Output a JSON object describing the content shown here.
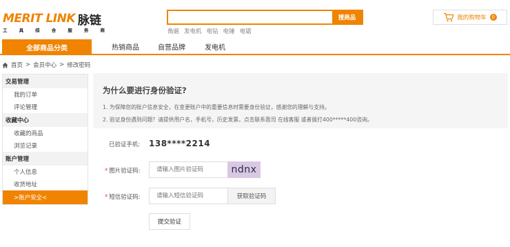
{
  "logo": {
    "english": "MERIT LINK",
    "chinese": "脉链",
    "tagline": [
      "工",
      "具",
      "综",
      "合",
      "服",
      "务",
      "商"
    ]
  },
  "search": {
    "placeholder": "",
    "button": "搜商品",
    "hot_words": [
      "角磨",
      "发电机",
      "电钻",
      "电锤",
      "电锯"
    ]
  },
  "cart": {
    "label": "我的购物车",
    "count": "0"
  },
  "nav": {
    "all_categories": "全部商品分类",
    "items": [
      "热销商品",
      "自营品牌",
      "发电机"
    ]
  },
  "breadcrumb": {
    "items": [
      "首页",
      ">",
      "会员中心",
      ">",
      "修改密码"
    ]
  },
  "sidebar": {
    "groups": [
      {
        "title": "交易管理",
        "items": [
          "我的订单",
          "评论管理"
        ]
      },
      {
        "title": "收藏中心",
        "items": [
          "收藏的商品",
          "浏览记录"
        ]
      },
      {
        "title": "账户管理",
        "items": [
          "个人信息",
          "收货地址",
          ">账户安全<"
        ]
      }
    ],
    "active_item": ">账户安全<"
  },
  "info": {
    "title": "为什么要进行身份验证?",
    "line1": "1. 为保障您的账户信息安全，在变更账户中的重要信息时需要身份验证，感谢您的理解与支持。",
    "line2": "2. 验证身份遇到问题？请提供用户名，手机号，历史发票，点击联系我司 在线客服 或者拨打400*****400咨询。"
  },
  "form": {
    "phone_label": "已验证手机:",
    "phone_value": "138****2214",
    "required_mark": "*",
    "image_code_label": "图片验证码:",
    "image_code_placeholder": "请输入图片验证码",
    "captcha_text": "ndnx",
    "sms_code_label": "短信验证码:",
    "sms_code_placeholder": "请输入短信验证码",
    "sms_button": "获取验证码",
    "submit_button": "提交验证"
  },
  "colors": {
    "brand_orange": "#f08300",
    "captcha_bg": "#d9c8e3",
    "required_red": "#ee3333"
  },
  "icons": {
    "cart": "cart-icon",
    "home": "home-icon"
  }
}
